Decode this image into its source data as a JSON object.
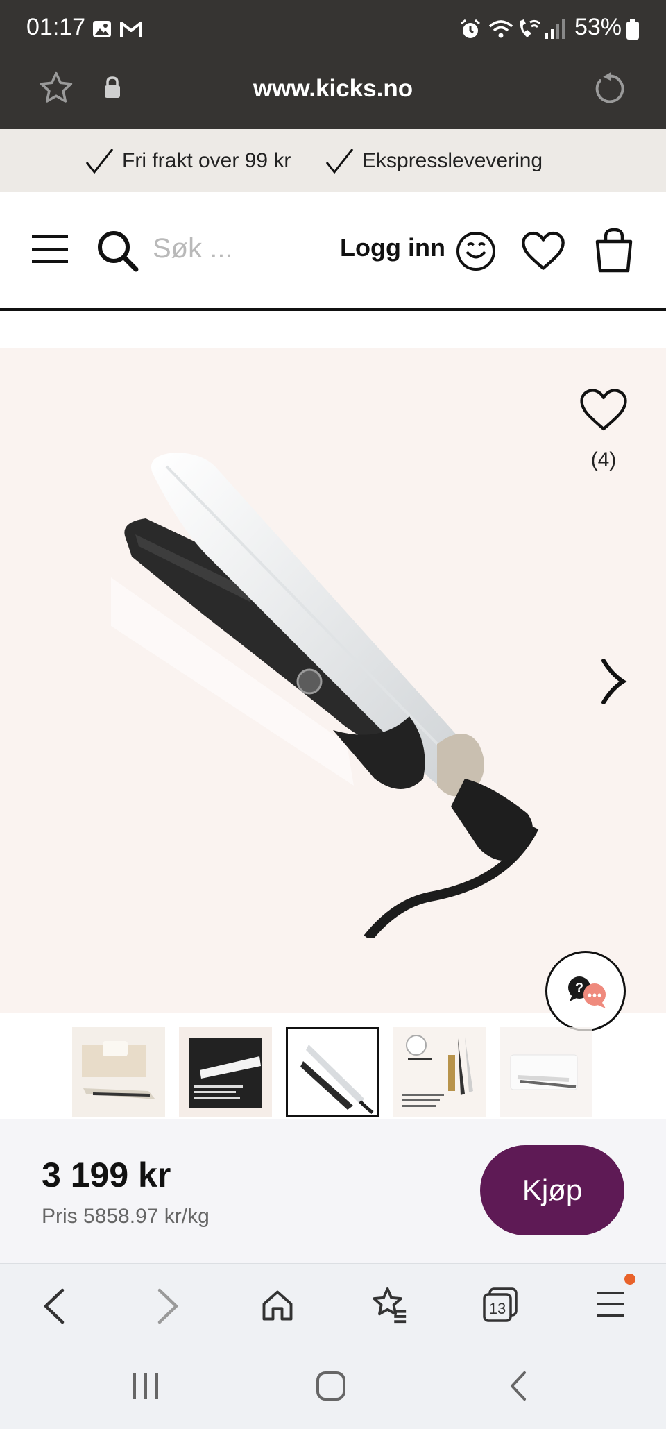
{
  "status_bar": {
    "time": "01:17",
    "battery": "53%",
    "icons": [
      "gallery-icon",
      "gmail-icon",
      "alarm-icon",
      "wifi-icon",
      "wifi-calling-icon",
      "signal-icon",
      "battery-icon"
    ]
  },
  "browser": {
    "url": "www.kicks.no",
    "tab_count": "13",
    "icons": [
      "star-icon",
      "lock-icon",
      "reload-icon"
    ]
  },
  "promo": {
    "item1": "Fri frakt over 99 kr",
    "item2": "Ekspresslevevering"
  },
  "header": {
    "search_placeholder": "Søk ...",
    "login_label": "Logg inn"
  },
  "product": {
    "favorites_count": "(4)",
    "price": "3 199 kr",
    "unit_price": "Pris 5858.97 kr/kg",
    "buy_label": "Kjøp",
    "thumbnails": [
      {
        "name": "thumb-1"
      },
      {
        "name": "thumb-2"
      },
      {
        "name": "thumb-3",
        "selected": true
      },
      {
        "name": "thumb-4"
      },
      {
        "name": "thumb-5"
      }
    ]
  },
  "colors": {
    "dark_bar": "#363432",
    "promo_bg": "#edeae6",
    "hero_bg": "#faf3f0",
    "buy_button": "#5e1a55",
    "notification_dot": "#e8622a"
  }
}
